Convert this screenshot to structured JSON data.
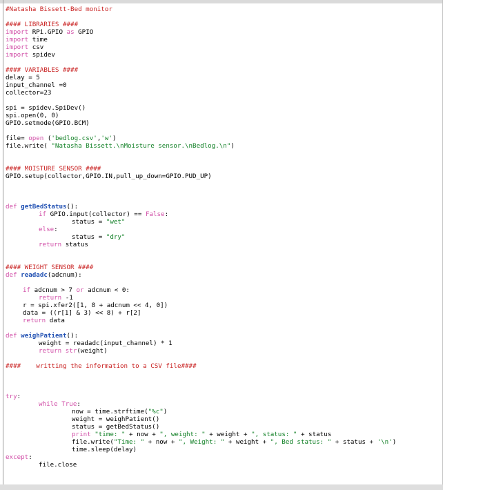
{
  "editor": {
    "lines": [
      {
        "parts": [
          {
            "t": "comment",
            "v": "#Natasha Bissett-Bed monitor"
          }
        ]
      },
      {
        "parts": []
      },
      {
        "parts": [
          {
            "t": "comment",
            "v": "#### LIBRARIES ####"
          }
        ]
      },
      {
        "parts": [
          {
            "t": "keyword",
            "v": "import"
          },
          {
            "t": "plain",
            "v": " RPi.GPIO "
          },
          {
            "t": "keyword",
            "v": "as"
          },
          {
            "t": "plain",
            "v": " GPIO"
          }
        ]
      },
      {
        "parts": [
          {
            "t": "keyword",
            "v": "import"
          },
          {
            "t": "plain",
            "v": " time"
          }
        ]
      },
      {
        "parts": [
          {
            "t": "keyword",
            "v": "import"
          },
          {
            "t": "plain",
            "v": " csv"
          }
        ]
      },
      {
        "parts": [
          {
            "t": "keyword",
            "v": "import"
          },
          {
            "t": "plain",
            "v": " spidev"
          }
        ]
      },
      {
        "parts": []
      },
      {
        "parts": [
          {
            "t": "comment",
            "v": "#### VARIABLES ####"
          }
        ]
      },
      {
        "parts": [
          {
            "t": "plain",
            "v": "delay = 5"
          }
        ]
      },
      {
        "parts": [
          {
            "t": "plain",
            "v": "input_channel =0"
          }
        ]
      },
      {
        "parts": [
          {
            "t": "plain",
            "v": "collector=23"
          }
        ]
      },
      {
        "parts": []
      },
      {
        "parts": [
          {
            "t": "plain",
            "v": "spi = spidev.SpiDev()"
          }
        ]
      },
      {
        "parts": [
          {
            "t": "plain",
            "v": "spi.open(0, 0)"
          }
        ]
      },
      {
        "parts": [
          {
            "t": "plain",
            "v": "GPIO.setmode(GPIO.BCM)"
          }
        ]
      },
      {
        "parts": []
      },
      {
        "parts": [
          {
            "t": "plain",
            "v": "file= "
          },
          {
            "t": "keyword",
            "v": "open"
          },
          {
            "t": "plain",
            "v": " ("
          },
          {
            "t": "string",
            "v": "'bedlog.csv'"
          },
          {
            "t": "plain",
            "v": ","
          },
          {
            "t": "string",
            "v": "'w'"
          },
          {
            "t": "plain",
            "v": ")"
          }
        ]
      },
      {
        "parts": [
          {
            "t": "plain",
            "v": "file.write( "
          },
          {
            "t": "string",
            "v": "\"Natasha Bissett.\\nMoisture sensor.\\nBedlog.\\n\""
          },
          {
            "t": "plain",
            "v": ")"
          }
        ]
      },
      {
        "parts": []
      },
      {
        "parts": []
      },
      {
        "parts": [
          {
            "t": "comment",
            "v": "#### MOISTURE SENSOR ####"
          }
        ]
      },
      {
        "parts": [
          {
            "t": "plain",
            "v": "GPIO.setup(collector,GPIO.IN,pull_up_down=GPIO.PUD_UP)"
          }
        ]
      },
      {
        "parts": []
      },
      {
        "parts": []
      },
      {
        "parts": []
      },
      {
        "parts": [
          {
            "t": "keyword",
            "v": "def"
          },
          {
            "t": "plain",
            "v": " "
          },
          {
            "t": "def",
            "v": "getBedStatus"
          },
          {
            "t": "plain",
            "v": "():"
          }
        ]
      },
      {
        "indent": 2,
        "parts": [
          {
            "t": "keyword",
            "v": "if"
          },
          {
            "t": "plain",
            "v": " GPIO.input(collector) == "
          },
          {
            "t": "keyword",
            "v": "False"
          },
          {
            "t": "plain",
            "v": ":"
          }
        ]
      },
      {
        "indent": 4,
        "parts": [
          {
            "t": "plain",
            "v": "status = "
          },
          {
            "t": "string",
            "v": "\"wet\""
          }
        ]
      },
      {
        "indent": 2,
        "parts": [
          {
            "t": "keyword",
            "v": "else"
          },
          {
            "t": "plain",
            "v": ":"
          }
        ]
      },
      {
        "indent": 4,
        "parts": [
          {
            "t": "plain",
            "v": "status = "
          },
          {
            "t": "string",
            "v": "\"dry\""
          }
        ]
      },
      {
        "indent": 2,
        "parts": [
          {
            "t": "keyword",
            "v": "return"
          },
          {
            "t": "plain",
            "v": " status"
          }
        ]
      },
      {
        "parts": []
      },
      {
        "parts": []
      },
      {
        "parts": [
          {
            "t": "comment",
            "v": "#### WEIGHT SENSOR ####"
          }
        ]
      },
      {
        "parts": [
          {
            "t": "keyword",
            "v": "def"
          },
          {
            "t": "plain",
            "v": " "
          },
          {
            "t": "def",
            "v": "readadc"
          },
          {
            "t": "plain",
            "v": "(adcnum):"
          }
        ]
      },
      {
        "parts": []
      },
      {
        "indent": 1,
        "parts": [
          {
            "t": "keyword",
            "v": "if"
          },
          {
            "t": "plain",
            "v": " adcnum > 7 "
          },
          {
            "t": "keyword",
            "v": "or"
          },
          {
            "t": "plain",
            "v": " adcnum < 0:"
          }
        ]
      },
      {
        "indent": 2,
        "parts": [
          {
            "t": "keyword",
            "v": "return"
          },
          {
            "t": "plain",
            "v": " -1"
          }
        ]
      },
      {
        "indent": 1,
        "parts": [
          {
            "t": "plain",
            "v": "r = spi.xfer2([1, 8 + adcnum << 4, 0])"
          }
        ]
      },
      {
        "indent": 1,
        "parts": [
          {
            "t": "plain",
            "v": "data = ((r[1] & 3) << 8) + r[2]"
          }
        ]
      },
      {
        "indent": 1,
        "parts": [
          {
            "t": "keyword",
            "v": "return"
          },
          {
            "t": "plain",
            "v": " data"
          }
        ]
      },
      {
        "parts": []
      },
      {
        "parts": [
          {
            "t": "keyword",
            "v": "def"
          },
          {
            "t": "plain",
            "v": " "
          },
          {
            "t": "def",
            "v": "weighPatient"
          },
          {
            "t": "plain",
            "v": "():"
          }
        ]
      },
      {
        "indent": 2,
        "parts": [
          {
            "t": "plain",
            "v": "weight = readadc(input_channel) * 1"
          }
        ]
      },
      {
        "indent": 2,
        "parts": [
          {
            "t": "keyword",
            "v": "return"
          },
          {
            "t": "plain",
            "v": " "
          },
          {
            "t": "keyword",
            "v": "str"
          },
          {
            "t": "plain",
            "v": "(weight)"
          }
        ]
      },
      {
        "parts": []
      },
      {
        "parts": [
          {
            "t": "comment",
            "v": "####"
          },
          {
            "t": "plain",
            "v": "    "
          },
          {
            "t": "comment",
            "v": "writting the information to a CSV file####"
          }
        ]
      },
      {
        "parts": []
      },
      {
        "parts": []
      },
      {
        "parts": []
      },
      {
        "parts": [
          {
            "t": "keyword",
            "v": "try"
          },
          {
            "t": "plain",
            "v": ":"
          }
        ]
      },
      {
        "indent": 2,
        "parts": [
          {
            "t": "keyword",
            "v": "while"
          },
          {
            "t": "plain",
            "v": " "
          },
          {
            "t": "keyword",
            "v": "True"
          },
          {
            "t": "plain",
            "v": ":"
          }
        ]
      },
      {
        "indent": 4,
        "parts": [
          {
            "t": "plain",
            "v": "now = time.strftime("
          },
          {
            "t": "string",
            "v": "\"%c\""
          },
          {
            "t": "plain",
            "v": ")"
          }
        ]
      },
      {
        "indent": 4,
        "parts": [
          {
            "t": "plain",
            "v": "weight = weighPatient()"
          }
        ]
      },
      {
        "indent": 4,
        "parts": [
          {
            "t": "plain",
            "v": "status = getBedStatus()"
          }
        ]
      },
      {
        "indent": 4,
        "parts": [
          {
            "t": "keyword",
            "v": "print"
          },
          {
            "t": "plain",
            "v": " "
          },
          {
            "t": "string",
            "v": "\"time: \""
          },
          {
            "t": "plain",
            "v": " + now + "
          },
          {
            "t": "string",
            "v": "\", weight: \""
          },
          {
            "t": "plain",
            "v": " + weight + "
          },
          {
            "t": "string",
            "v": "\", status: \""
          },
          {
            "t": "plain",
            "v": " + status"
          }
        ]
      },
      {
        "indent": 4,
        "parts": [
          {
            "t": "plain",
            "v": "file.write("
          },
          {
            "t": "string",
            "v": "\"Time: \""
          },
          {
            "t": "plain",
            "v": " + now + "
          },
          {
            "t": "string",
            "v": "\", Weight: \""
          },
          {
            "t": "plain",
            "v": " + weight + "
          },
          {
            "t": "string",
            "v": "\", Bed status: \""
          },
          {
            "t": "plain",
            "v": " + status + "
          },
          {
            "t": "string",
            "v": "'\\n'"
          },
          {
            "t": "plain",
            "v": ")"
          }
        ]
      },
      {
        "indent": 4,
        "parts": [
          {
            "t": "plain",
            "v": "time.sleep(delay)"
          }
        ]
      },
      {
        "parts": [
          {
            "t": "keyword",
            "v": "except"
          },
          {
            "t": "plain",
            "v": ":"
          }
        ]
      },
      {
        "indent": 2,
        "parts": [
          {
            "t": "plain",
            "v": "file.close"
          }
        ]
      }
    ]
  }
}
